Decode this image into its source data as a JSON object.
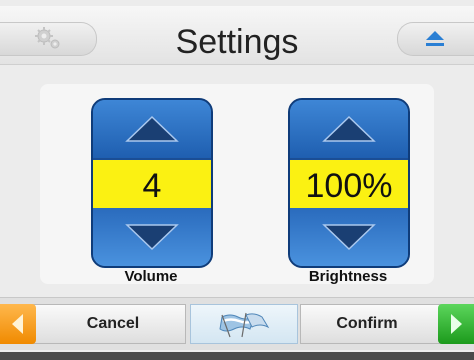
{
  "header": {
    "title": "Settings",
    "settings_icon": "gear-icon",
    "eject_icon": "eject-icon"
  },
  "controls": {
    "volume": {
      "label": "Volume",
      "value": "4"
    },
    "brightness": {
      "label": "Brightness",
      "value": "100%"
    }
  },
  "footer": {
    "cancel_label": "Cancel",
    "confirm_label": "Confirm",
    "language_icon": "flags-icon"
  },
  "colors": {
    "accent_blue": "#2f6ebe",
    "value_yellow": "#fbf112",
    "cancel_orange": "#f08a00",
    "confirm_green": "#1c9a1c"
  }
}
